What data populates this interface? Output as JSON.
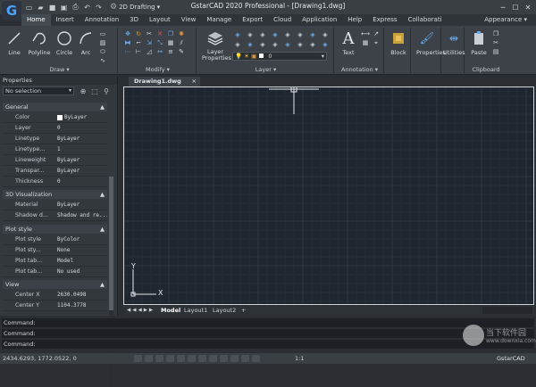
{
  "app": {
    "title": "GstarCAD 2020 Professional - [Drawing1.dwg]",
    "workspace": "2D Drafting",
    "logo_letter": "G"
  },
  "ribbon_tabs": [
    "Home",
    "Insert",
    "Annotation",
    "3D",
    "Layout",
    "View",
    "Manage",
    "Export",
    "Cloud",
    "Application",
    "Help",
    "Express",
    "Collaborati"
  ],
  "appearance_label": "Appearance",
  "ribbon": {
    "draw": {
      "title": "Draw",
      "line": "Line",
      "polyline": "Polyline",
      "circle": "Circle",
      "arc": "Arc"
    },
    "modify": {
      "title": "Modify"
    },
    "layer": {
      "title": "Layer",
      "properties": "Layer Properties",
      "current_layer": "0"
    },
    "annotation": {
      "title": "Annotation",
      "text": "Text"
    },
    "block": "Block",
    "properties": "Properties",
    "utilities": "Utilities",
    "clipboard": {
      "title": "Clipboard",
      "paste": "Paste"
    }
  },
  "properties_panel": {
    "title": "Properties",
    "selection": "No selection",
    "sections": {
      "general": "General",
      "visualization": "3D Visualization",
      "plot": "Plot style",
      "view": "View"
    },
    "rows": [
      {
        "k": "Color",
        "v": "ByLayer"
      },
      {
        "k": "Layer",
        "v": "0"
      },
      {
        "k": "Linetype",
        "v": "ByLayer"
      },
      {
        "k": "Linetype...",
        "v": "1"
      },
      {
        "k": "Lineweight",
        "v": "ByLayer"
      },
      {
        "k": "Transpar...",
        "v": "ByLayer"
      },
      {
        "k": "Thickness",
        "v": "0"
      },
      {
        "k": "Material",
        "v": "ByLayer"
      },
      {
        "k": "Shadow d...",
        "v": "Shadow and re..."
      },
      {
        "k": "Plot style",
        "v": "ByColor"
      },
      {
        "k": "Plot sty...",
        "v": "None"
      },
      {
        "k": "Plot tab...",
        "v": "Model"
      },
      {
        "k": "Plot tab...",
        "v": "No used"
      },
      {
        "k": "Center X",
        "v": "2630.0498"
      },
      {
        "k": "Center Y",
        "v": "1104.3778"
      }
    ]
  },
  "doc_tab": "Drawing1.dwg",
  "ucs": {
    "x": "X",
    "y": "Y"
  },
  "layout_tabs": {
    "model": "Model",
    "layout1": "Layout1",
    "layout2": "Layout2",
    "add": "+"
  },
  "command_lines": [
    "Command:",
    "Command:",
    "Command:"
  ],
  "status": {
    "coords": "2434.6293, 1772.0522, 0",
    "scale": "1:1",
    "brand": "GstarCAD"
  },
  "watermark": {
    "line1": "当下软件园",
    "line2": "www.downxia.com"
  },
  "colors": {
    "canvas": "#1f2630",
    "accent": "#4aa3ff"
  }
}
